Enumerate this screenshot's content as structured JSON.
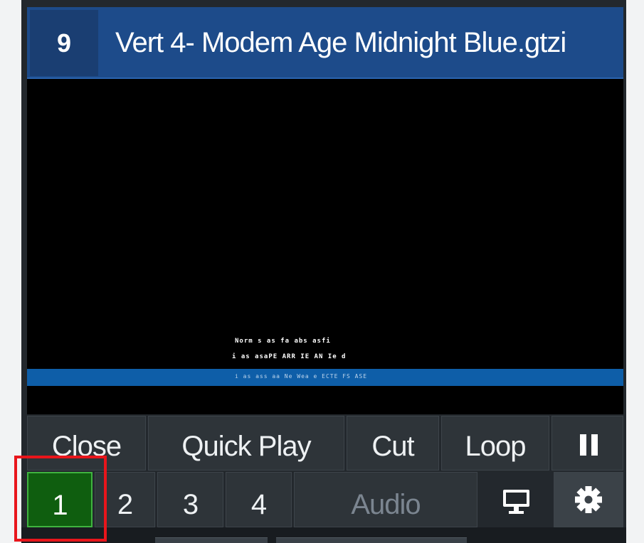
{
  "input": {
    "number": "9",
    "title": "Vert 4- Modem Age Midnight Blue.gtzi"
  },
  "preview": {
    "lower_third": {
      "line1": "Norm s as fa abs asfi",
      "line2": "i as asaPE ARR IE AN Ie d",
      "line3": "i as ass aa Ne Wea e ECTE FS ASE",
      "bar_color": "#0e5ea8"
    }
  },
  "controls": {
    "close_label": "Close",
    "quick_play_label": "Quick Play",
    "cut_label": "Cut",
    "loop_label": "Loop",
    "pause_icon": "pause-icon"
  },
  "overlays": {
    "channels": [
      "1",
      "2",
      "3",
      "4"
    ],
    "active": "1",
    "active_color": "#0f5e0f",
    "audio_label": "Audio",
    "external_icon": "monitor-icon",
    "settings_icon": "gear-icon"
  },
  "highlight_color": "#e8151b"
}
